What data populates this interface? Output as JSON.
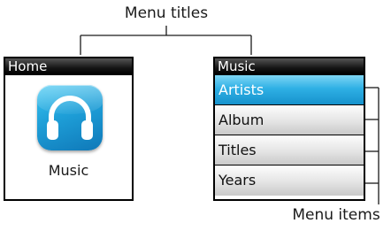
{
  "annotations": {
    "menu_titles": "Menu titles",
    "menu_items": "Menu items"
  },
  "home_screen": {
    "title": "Home",
    "app_icon": "headphones-icon",
    "app_label": "Music"
  },
  "music_screen": {
    "title": "Music",
    "items": [
      {
        "label": "Artists",
        "selected": true
      },
      {
        "label": "Album",
        "selected": false
      },
      {
        "label": "Titles",
        "selected": false
      },
      {
        "label": "Years",
        "selected": false
      }
    ]
  },
  "colors": {
    "selected_item": "#2fb0e5",
    "titlebar": "#000000",
    "icon_blue": "#1e9fd8"
  }
}
